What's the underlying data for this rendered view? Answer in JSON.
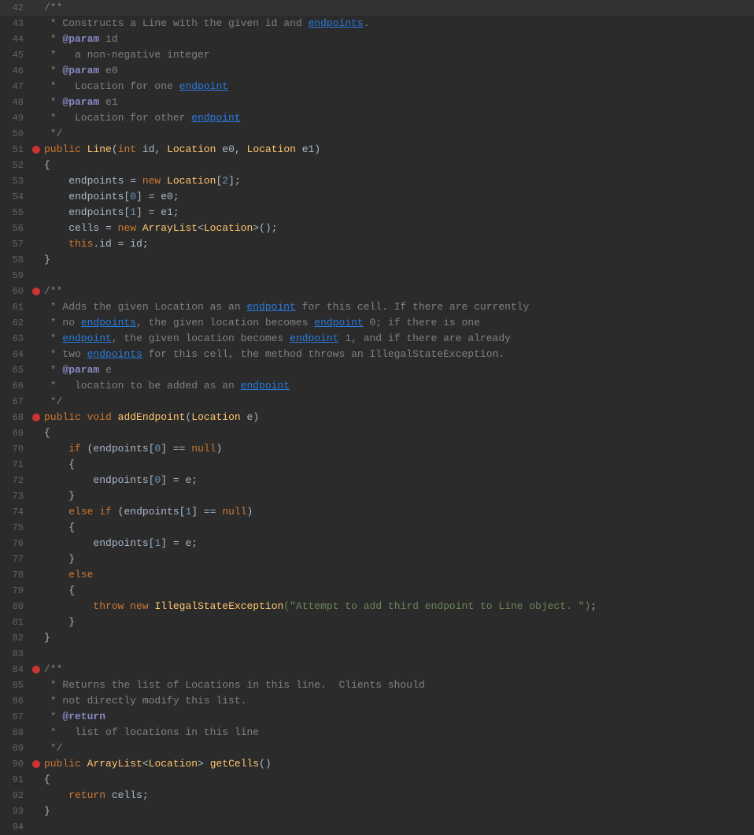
{
  "editor": {
    "background": "#2b2b2b",
    "lines": [
      {
        "num": "42",
        "bp": false,
        "content": [
          {
            "t": "c-comment",
            "v": "/**"
          }
        ]
      },
      {
        "num": "43",
        "bp": false,
        "content": [
          {
            "t": "c-comment",
            "v": " * Constructs a Line with the given id and "
          },
          {
            "t": "c-link",
            "v": "endpoints"
          },
          {
            "t": "c-comment",
            "v": "."
          }
        ]
      },
      {
        "num": "44",
        "bp": false,
        "content": [
          {
            "t": "c-comment",
            "v": " * "
          },
          {
            "t": "c-param",
            "v": "@param"
          },
          {
            "t": "c-comment",
            "v": " id"
          }
        ]
      },
      {
        "num": "45",
        "bp": false,
        "content": [
          {
            "t": "c-comment",
            "v": " *   a non-negative integer"
          }
        ]
      },
      {
        "num": "46",
        "bp": false,
        "content": [
          {
            "t": "c-comment",
            "v": " * "
          },
          {
            "t": "c-param",
            "v": "@param"
          },
          {
            "t": "c-comment",
            "v": " e0"
          }
        ]
      },
      {
        "num": "47",
        "bp": false,
        "content": [
          {
            "t": "c-comment",
            "v": " *   Location for one "
          },
          {
            "t": "c-link",
            "v": "endpoint"
          }
        ]
      },
      {
        "num": "48",
        "bp": false,
        "content": [
          {
            "t": "c-comment",
            "v": " * "
          },
          {
            "t": "c-param",
            "v": "@param"
          },
          {
            "t": "c-comment",
            "v": " e1"
          }
        ]
      },
      {
        "num": "49",
        "bp": false,
        "content": [
          {
            "t": "c-comment",
            "v": " *   Location for other "
          },
          {
            "t": "c-link",
            "v": "endpoint"
          }
        ]
      },
      {
        "num": "50",
        "bp": false,
        "content": [
          {
            "t": "c-comment",
            "v": " */"
          }
        ]
      },
      {
        "num": "51",
        "bp": true,
        "content": [
          {
            "t": "c-keyword",
            "v": "public"
          },
          {
            "t": "c-var",
            "v": " "
          },
          {
            "t": "c-class",
            "v": "Line"
          },
          {
            "t": "c-var",
            "v": "("
          },
          {
            "t": "c-keyword",
            "v": "int"
          },
          {
            "t": "c-var",
            "v": " id, "
          },
          {
            "t": "c-class",
            "v": "Location"
          },
          {
            "t": "c-var",
            "v": " e0, "
          },
          {
            "t": "c-class",
            "v": "Location"
          },
          {
            "t": "c-var",
            "v": " e1)"
          }
        ]
      },
      {
        "num": "52",
        "bp": false,
        "content": [
          {
            "t": "c-var",
            "v": "{"
          }
        ]
      },
      {
        "num": "53",
        "bp": false,
        "content": [
          {
            "t": "c-var",
            "v": "    endpoints = "
          },
          {
            "t": "c-keyword",
            "v": "new"
          },
          {
            "t": "c-var",
            "v": " "
          },
          {
            "t": "c-class",
            "v": "Location"
          },
          {
            "t": "c-var",
            "v": "["
          },
          {
            "t": "c-number",
            "v": "2"
          },
          {
            "t": "c-var",
            "v": "];"
          }
        ]
      },
      {
        "num": "54",
        "bp": false,
        "content": [
          {
            "t": "c-var",
            "v": "    endpoints["
          },
          {
            "t": "c-number",
            "v": "0"
          },
          {
            "t": "c-var",
            "v": "] = e0;"
          }
        ]
      },
      {
        "num": "55",
        "bp": false,
        "content": [
          {
            "t": "c-var",
            "v": "    endpoints["
          },
          {
            "t": "c-number",
            "v": "1"
          },
          {
            "t": "c-var",
            "v": "] = e1;"
          }
        ]
      },
      {
        "num": "56",
        "bp": false,
        "content": [
          {
            "t": "c-var",
            "v": "    cells = "
          },
          {
            "t": "c-keyword",
            "v": "new"
          },
          {
            "t": "c-var",
            "v": " "
          },
          {
            "t": "c-class",
            "v": "ArrayList"
          },
          {
            "t": "c-var",
            "v": "<"
          },
          {
            "t": "c-class",
            "v": "Location"
          },
          {
            "t": "c-var",
            "v": ">();"
          }
        ]
      },
      {
        "num": "57",
        "bp": false,
        "content": [
          {
            "t": "c-keyword",
            "v": "    this"
          },
          {
            "t": "c-var",
            "v": ".id = id;"
          }
        ]
      },
      {
        "num": "58",
        "bp": false,
        "content": [
          {
            "t": "c-var",
            "v": "}"
          }
        ]
      },
      {
        "num": "59",
        "bp": false,
        "content": []
      },
      {
        "num": "60",
        "bp": true,
        "content": [
          {
            "t": "c-comment",
            "v": "/**"
          }
        ]
      },
      {
        "num": "61",
        "bp": false,
        "content": [
          {
            "t": "c-comment",
            "v": " * Adds the given Location as an "
          },
          {
            "t": "c-link",
            "v": "endpoint"
          },
          {
            "t": "c-comment",
            "v": " for this cell. If there are currently"
          }
        ]
      },
      {
        "num": "62",
        "bp": false,
        "content": [
          {
            "t": "c-comment",
            "v": " * no "
          },
          {
            "t": "c-link",
            "v": "endpoints"
          },
          {
            "t": "c-comment",
            "v": ", the given location becomes "
          },
          {
            "t": "c-link",
            "v": "endpoint"
          },
          {
            "t": "c-comment",
            "v": " 0; if there is one"
          }
        ]
      },
      {
        "num": "63",
        "bp": false,
        "content": [
          {
            "t": "c-comment",
            "v": " * "
          },
          {
            "t": "c-link",
            "v": "endpoint"
          },
          {
            "t": "c-comment",
            "v": ", the given location becomes "
          },
          {
            "t": "c-link",
            "v": "endpoint"
          },
          {
            "t": "c-comment",
            "v": " 1, and if there are already"
          }
        ]
      },
      {
        "num": "64",
        "bp": false,
        "content": [
          {
            "t": "c-comment",
            "v": " * two "
          },
          {
            "t": "c-link",
            "v": "endpoints"
          },
          {
            "t": "c-comment",
            "v": " for this cell, the method throws an IllegalStateException."
          }
        ]
      },
      {
        "num": "65",
        "bp": false,
        "content": [
          {
            "t": "c-comment",
            "v": " * "
          },
          {
            "t": "c-param",
            "v": "@param"
          },
          {
            "t": "c-comment",
            "v": " e"
          }
        ]
      },
      {
        "num": "66",
        "bp": false,
        "content": [
          {
            "t": "c-comment",
            "v": " *   location to be added as an "
          },
          {
            "t": "c-link",
            "v": "endpoint"
          }
        ]
      },
      {
        "num": "67",
        "bp": false,
        "content": [
          {
            "t": "c-comment",
            "v": " */"
          }
        ]
      },
      {
        "num": "68",
        "bp": true,
        "content": [
          {
            "t": "c-keyword",
            "v": "public"
          },
          {
            "t": "c-var",
            "v": " "
          },
          {
            "t": "c-keyword",
            "v": "void"
          },
          {
            "t": "c-var",
            "v": " "
          },
          {
            "t": "c-method",
            "v": "addEndpoint"
          },
          {
            "t": "c-var",
            "v": "("
          },
          {
            "t": "c-class",
            "v": "Location"
          },
          {
            "t": "c-var",
            "v": " e)"
          }
        ]
      },
      {
        "num": "69",
        "bp": false,
        "content": [
          {
            "t": "c-var",
            "v": "{"
          }
        ]
      },
      {
        "num": "70",
        "bp": false,
        "content": [
          {
            "t": "c-var",
            "v": "    "
          },
          {
            "t": "c-keyword",
            "v": "if"
          },
          {
            "t": "c-var",
            "v": " (endpoints["
          },
          {
            "t": "c-number",
            "v": "0"
          },
          {
            "t": "c-var",
            "v": "] == "
          },
          {
            "t": "c-keyword",
            "v": "null"
          },
          {
            "t": "c-var",
            "v": ")"
          }
        ]
      },
      {
        "num": "71",
        "bp": false,
        "content": [
          {
            "t": "c-var",
            "v": "    {"
          }
        ]
      },
      {
        "num": "72",
        "bp": false,
        "content": [
          {
            "t": "c-var",
            "v": "        endpoints["
          },
          {
            "t": "c-number",
            "v": "0"
          },
          {
            "t": "c-var",
            "v": "] = e;"
          }
        ]
      },
      {
        "num": "73",
        "bp": false,
        "content": [
          {
            "t": "c-var",
            "v": "    }"
          }
        ]
      },
      {
        "num": "74",
        "bp": false,
        "content": [
          {
            "t": "c-var",
            "v": "    "
          },
          {
            "t": "c-keyword",
            "v": "else"
          },
          {
            "t": "c-var",
            "v": " "
          },
          {
            "t": "c-keyword",
            "v": "if"
          },
          {
            "t": "c-var",
            "v": " (endpoints["
          },
          {
            "t": "c-number",
            "v": "1"
          },
          {
            "t": "c-var",
            "v": "] == "
          },
          {
            "t": "c-keyword",
            "v": "null"
          },
          {
            "t": "c-var",
            "v": ")"
          }
        ]
      },
      {
        "num": "75",
        "bp": false,
        "content": [
          {
            "t": "c-var",
            "v": "    {"
          }
        ]
      },
      {
        "num": "76",
        "bp": false,
        "content": [
          {
            "t": "c-var",
            "v": "        endpoints["
          },
          {
            "t": "c-number",
            "v": "1"
          },
          {
            "t": "c-var",
            "v": "] = e;"
          }
        ]
      },
      {
        "num": "77",
        "bp": false,
        "content": [
          {
            "t": "c-var",
            "v": "    }"
          }
        ]
      },
      {
        "num": "78",
        "bp": false,
        "content": [
          {
            "t": "c-var",
            "v": "    "
          },
          {
            "t": "c-keyword",
            "v": "else"
          }
        ]
      },
      {
        "num": "79",
        "bp": false,
        "content": [
          {
            "t": "c-var",
            "v": "    {"
          }
        ]
      },
      {
        "num": "80",
        "bp": false,
        "content": [
          {
            "t": "c-var",
            "v": "        "
          },
          {
            "t": "c-keyword",
            "v": "throw"
          },
          {
            "t": "c-var",
            "v": " "
          },
          {
            "t": "c-keyword",
            "v": "new"
          },
          {
            "t": "c-var",
            "v": " "
          },
          {
            "t": "c-class",
            "v": "IllegalStateException"
          },
          {
            "t": "c-string",
            "v": "(\"Attempt to add third endpoint to Line object. \")"
          }
        ],
        "has_semicolon": true
      },
      {
        "num": "81",
        "bp": false,
        "content": [
          {
            "t": "c-var",
            "v": "    }"
          }
        ]
      },
      {
        "num": "82",
        "bp": false,
        "content": [
          {
            "t": "c-var",
            "v": "}"
          }
        ]
      },
      {
        "num": "83",
        "bp": false,
        "content": []
      },
      {
        "num": "84",
        "bp": true,
        "content": [
          {
            "t": "c-comment",
            "v": "/**"
          }
        ]
      },
      {
        "num": "85",
        "bp": false,
        "content": [
          {
            "t": "c-comment",
            "v": " * Returns the list of Locations in this line.  Clients should"
          }
        ]
      },
      {
        "num": "86",
        "bp": false,
        "content": [
          {
            "t": "c-comment",
            "v": " * not directly modify this list."
          }
        ]
      },
      {
        "num": "87",
        "bp": false,
        "content": [
          {
            "t": "c-comment",
            "v": " * "
          },
          {
            "t": "c-param",
            "v": "@return"
          }
        ]
      },
      {
        "num": "88",
        "bp": false,
        "content": [
          {
            "t": "c-comment",
            "v": " *   list of locations in this line"
          }
        ]
      },
      {
        "num": "89",
        "bp": false,
        "content": [
          {
            "t": "c-comment",
            "v": " */"
          }
        ]
      },
      {
        "num": "90",
        "bp": true,
        "content": [
          {
            "t": "c-keyword",
            "v": "public"
          },
          {
            "t": "c-var",
            "v": " "
          },
          {
            "t": "c-class",
            "v": "ArrayList"
          },
          {
            "t": "c-var",
            "v": "<"
          },
          {
            "t": "c-class",
            "v": "Location"
          },
          {
            "t": "c-var",
            "v": "> "
          },
          {
            "t": "c-method",
            "v": "getCells"
          },
          {
            "t": "c-var",
            "v": "()"
          }
        ]
      },
      {
        "num": "91",
        "bp": false,
        "content": [
          {
            "t": "c-var",
            "v": "{"
          }
        ]
      },
      {
        "num": "92",
        "bp": false,
        "content": [
          {
            "t": "c-var",
            "v": "    "
          },
          {
            "t": "c-keyword",
            "v": "return"
          },
          {
            "t": "c-var",
            "v": " cells;"
          }
        ]
      },
      {
        "num": "93",
        "bp": false,
        "content": [
          {
            "t": "c-var",
            "v": "}"
          }
        ]
      },
      {
        "num": "94",
        "bp": false,
        "content": []
      }
    ]
  }
}
